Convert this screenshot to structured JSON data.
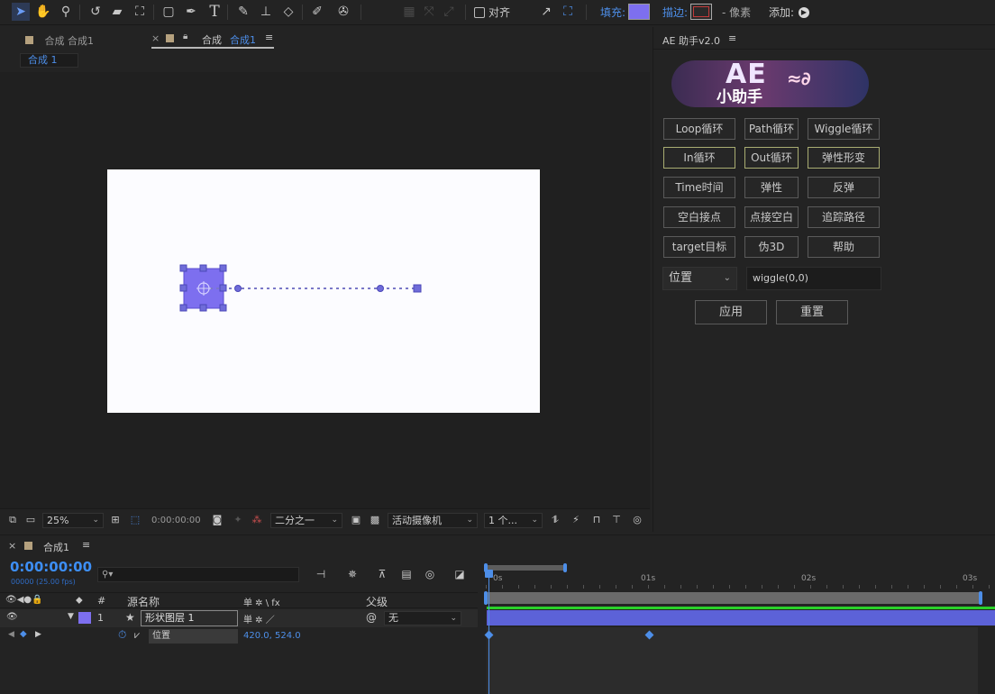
{
  "toolbar": {
    "align_label": "对齐",
    "fill_label": "填充:",
    "stroke_label": "描边:",
    "pixel_label": "- 像素",
    "add_label": "添加:",
    "fill_color": "#7d6fef",
    "stroke_color": "#c23b3b"
  },
  "comp_tabs": {
    "tab1": "合成 合成1",
    "tab2_prefix": "合成",
    "tab2_name": "合成1",
    "menu_glyph": "≡",
    "close_glyph": "×",
    "breadcrumb": "合成 1"
  },
  "comp_footer": {
    "zoom": "25%",
    "timecode": "0:00:00:00",
    "resolution": "二分之一",
    "camera": "活动摄像机",
    "views": "1 个..."
  },
  "ae_panel": {
    "title": "AE 助手v2.0",
    "menu_glyph": "≡",
    "logo_main": "AE",
    "logo_sub": "小助手",
    "buttons": [
      "Loop循环",
      "Path循环",
      "Wiggle循环",
      "In循环",
      "Out循环",
      "弹性形变",
      "Time时间",
      "弹性",
      "反弹",
      "空白接点",
      "点接空白",
      "追踪路径",
      "target目标",
      "伪3D",
      "帮助"
    ],
    "property_select": "位置",
    "expression_value": "wiggle(0,0)",
    "apply_label": "应用",
    "reset_label": "重置"
  },
  "timeline": {
    "tab_label": "合成1",
    "timecode": "0:00:00:00",
    "fps": "00000 (25.00 fps)",
    "col_num": "#",
    "col_source": "源名称",
    "col_switches": "单 ✲ \\ fx",
    "col_parent": "父级",
    "layer_num": "1",
    "layer_name": "形状图层 1",
    "parent_value": "无",
    "prop_name": "位置",
    "prop_value": "420.0, 524.0",
    "ruler": [
      "0s",
      "01s",
      "02s",
      "03s"
    ]
  }
}
